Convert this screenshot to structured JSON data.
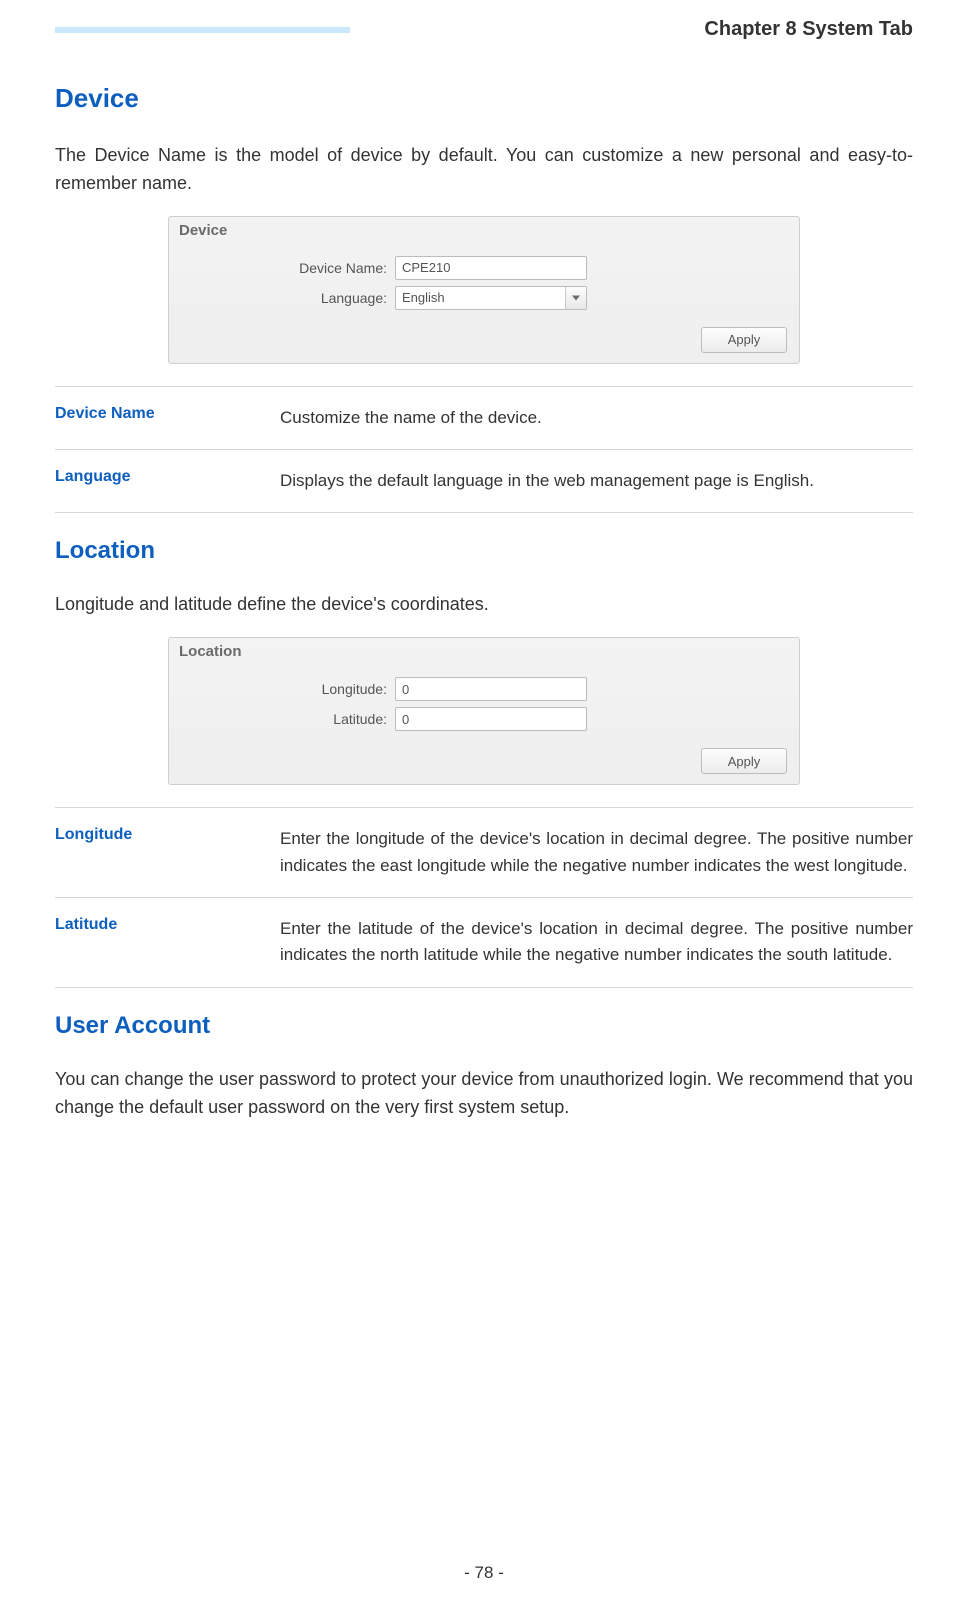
{
  "header": {
    "chapter": "Chapter 8 System Tab"
  },
  "device": {
    "heading": "Device",
    "intro": "The Device Name is the model of device by default. You can customize a new personal and easy-to-remember name.",
    "panel": {
      "title": "Device",
      "name_label": "Device Name:",
      "name_value": "CPE210",
      "lang_label": "Language:",
      "lang_value": "English",
      "apply": "Apply"
    },
    "rows": {
      "device_name_term": "Device Name",
      "device_name_desc": "Customize the name of the device.",
      "language_term": "Language",
      "language_desc": "Displays the default language in the web management page is English."
    }
  },
  "location": {
    "heading": "Location",
    "intro": "Longitude and latitude define the device's coordinates.",
    "panel": {
      "title": "Location",
      "lon_label": "Longitude:",
      "lon_value": "0",
      "lat_label": "Latitude:",
      "lat_value": "0",
      "apply": "Apply"
    },
    "rows": {
      "longitude_term": "Longitude",
      "longitude_desc": "Enter the longitude of the device's location in decimal degree. The positive number indicates the east longitude while the negative number indicates the west longitude.",
      "latitude_term": "Latitude",
      "latitude_desc": "Enter the latitude of the device's location in decimal degree. The positive number indicates the north latitude while the negative number indicates the south latitude."
    }
  },
  "user_account": {
    "heading": "User Account",
    "intro": "You can change the user password to protect your device from unauthorized login. We recommend that you change the default user password on the very first system setup."
  },
  "footer": {
    "page_number": "- 78 -"
  }
}
